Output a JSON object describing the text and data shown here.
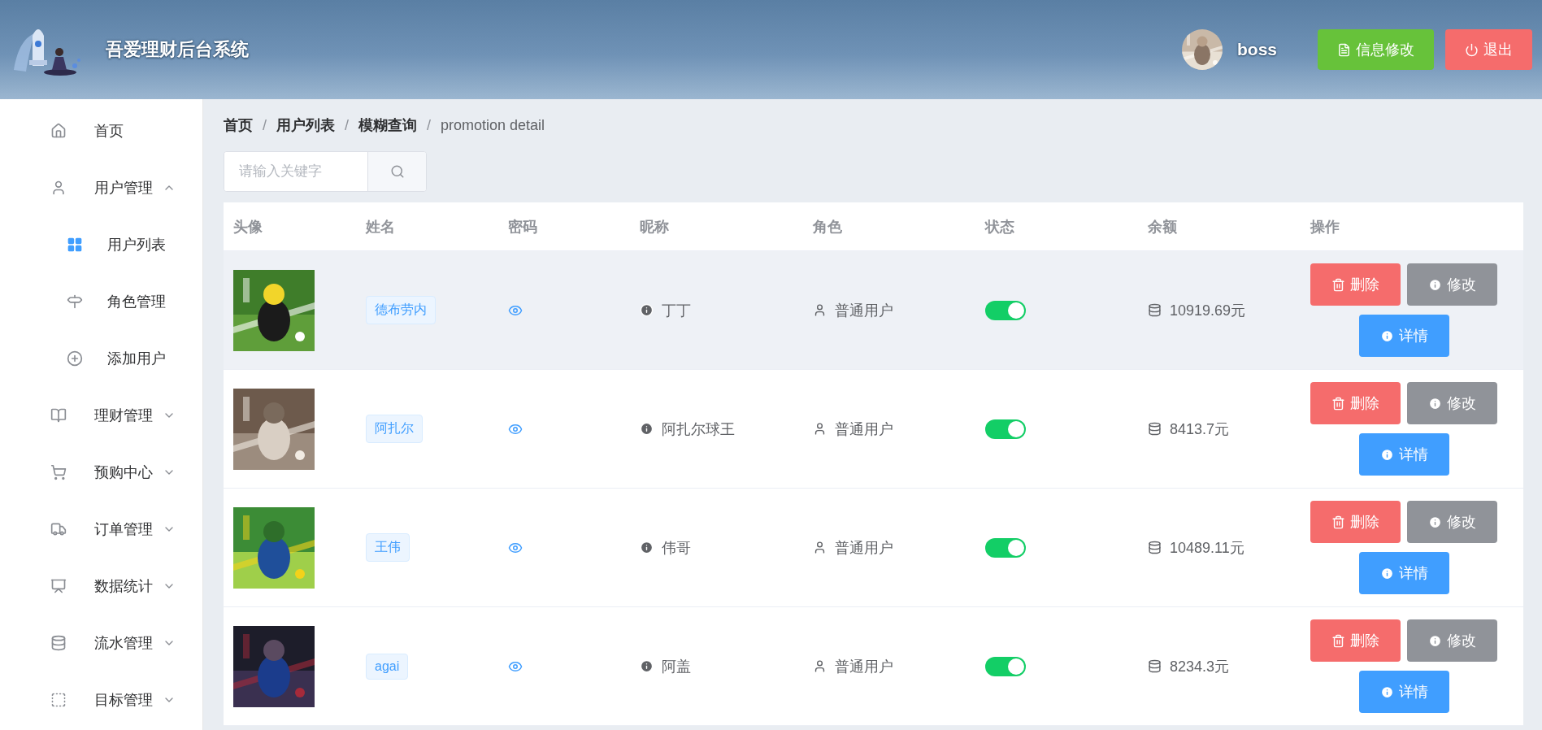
{
  "header": {
    "title": "吾爱理财后台系统",
    "username": "boss",
    "buttons": [
      {
        "kind": "edit",
        "label": "信息修改"
      },
      {
        "kind": "logout",
        "label": "退出"
      }
    ]
  },
  "sidebar": {
    "items": [
      {
        "label": "首页"
      },
      {
        "label": "用户管理",
        "expanded": true,
        "children": [
          {
            "label": "用户列表"
          },
          {
            "label": "角色管理"
          },
          {
            "label": "添加用户"
          }
        ]
      },
      {
        "label": "理财管理",
        "expanded": false
      },
      {
        "label": "预购中心",
        "expanded": false
      },
      {
        "label": "订单管理",
        "expanded": false
      },
      {
        "label": "数据统计",
        "expanded": false
      },
      {
        "label": "流水管理",
        "expanded": false
      },
      {
        "label": "目标管理",
        "expanded": false
      }
    ]
  },
  "breadcrumb": [
    {
      "label": "首页",
      "link": true
    },
    {
      "separator": "/",
      "label": "用户列表",
      "link": true
    },
    {
      "separator": "/",
      "label": "模糊查询",
      "link": true
    },
    {
      "separator": "/",
      "label": "promotion detail",
      "link": false
    }
  ],
  "search": {
    "placeholder": "请输入关键字"
  },
  "table": {
    "columns": [
      "头像",
      "姓名",
      "密码",
      "昵称",
      "角色",
      "状态",
      "余额",
      "操作"
    ],
    "rows": [
      {
        "highlighted": true,
        "name": "德布劳内",
        "nickname": "丁丁",
        "role": "普通用户",
        "on": true,
        "balance": "10919.69元",
        "actions": [
          "删除",
          "修改",
          "详情"
        ]
      },
      {
        "highlighted": false,
        "name": "阿扎尔",
        "nickname": "阿扎尔球王",
        "role": "普通用户",
        "on": true,
        "balance": "8413.7元",
        "actions": [
          "删除",
          "修改",
          "详情"
        ]
      },
      {
        "highlighted": false,
        "name": "王伟",
        "nickname": "伟哥",
        "role": "普通用户",
        "on": true,
        "balance": "10489.11元",
        "actions": [
          "删除",
          "修改",
          "详情"
        ]
      },
      {
        "highlighted": false,
        "name": "agai",
        "nickname": "阿盖",
        "role": "普通用户",
        "on": true,
        "balance": "8234.3元",
        "actions": [
          "删除",
          "修改",
          "详情"
        ]
      }
    ]
  }
}
